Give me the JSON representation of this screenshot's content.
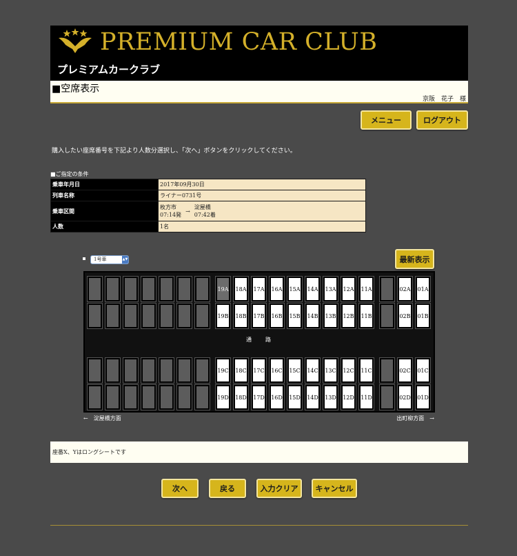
{
  "header": {
    "brand": "PREMIUM CAR CLUB",
    "brand_kana": "プレミアムカークラブ",
    "logo_color": "#d4b02a"
  },
  "subheader": {
    "title": "■空席表示",
    "user": "京阪　花子　様"
  },
  "nav": {
    "menu": "メニュー",
    "logout": "ログアウト"
  },
  "instruction": "購入したい座席番号を下記より人数分選択し、「次へ」ボタンをクリックしてください。",
  "conditions": {
    "title": "■ご指定の条件",
    "rows": [
      {
        "label": "乗車年月日",
        "value": "2017年09月30日"
      },
      {
        "label": "列車名称",
        "value": "ライナー0731号"
      },
      {
        "label": "乗車区間",
        "from": "枚方市",
        "from_time": "07:14発",
        "arrow": "→",
        "to": "淀屋橋",
        "to_time": "07:42着"
      },
      {
        "label": "人数",
        "value": "1名"
      }
    ]
  },
  "seatmap": {
    "car": "1号車",
    "refresh": "最新表示",
    "aisle": "通　路",
    "dir_left": "←　淀屋橋方面",
    "dir_right": "出町柳方面　→",
    "rows": {
      "A": [
        "19A",
        "18A",
        "17A",
        "16A",
        "15A",
        "14A",
        "13A",
        "12A",
        "11A",
        "02A",
        "01A"
      ],
      "B": [
        "19B",
        "18B",
        "17B",
        "16B",
        "15B",
        "14B",
        "13B",
        "12B",
        "11B",
        "02B",
        "01B"
      ],
      "C": [
        "19C",
        "18C",
        "17C",
        "16C",
        "15C",
        "14C",
        "13C",
        "12C",
        "11C",
        "02C",
        "01C"
      ],
      "D": [
        "19D",
        "18D",
        "17D",
        "16D",
        "15D",
        "14D",
        "13D",
        "12D",
        "11D",
        "02D",
        "01D"
      ]
    },
    "selected_seat": "19A"
  },
  "note": "座番X、Yはロングシートです",
  "actions": {
    "next": "次へ",
    "back": "戻る",
    "clear": "入力クリア",
    "cancel": "キャンセル"
  },
  "colors": {
    "background": "#4a4a4a",
    "gold": "#d6b51c",
    "panel": "#fffef2",
    "table_value": "#f6e6c4"
  }
}
